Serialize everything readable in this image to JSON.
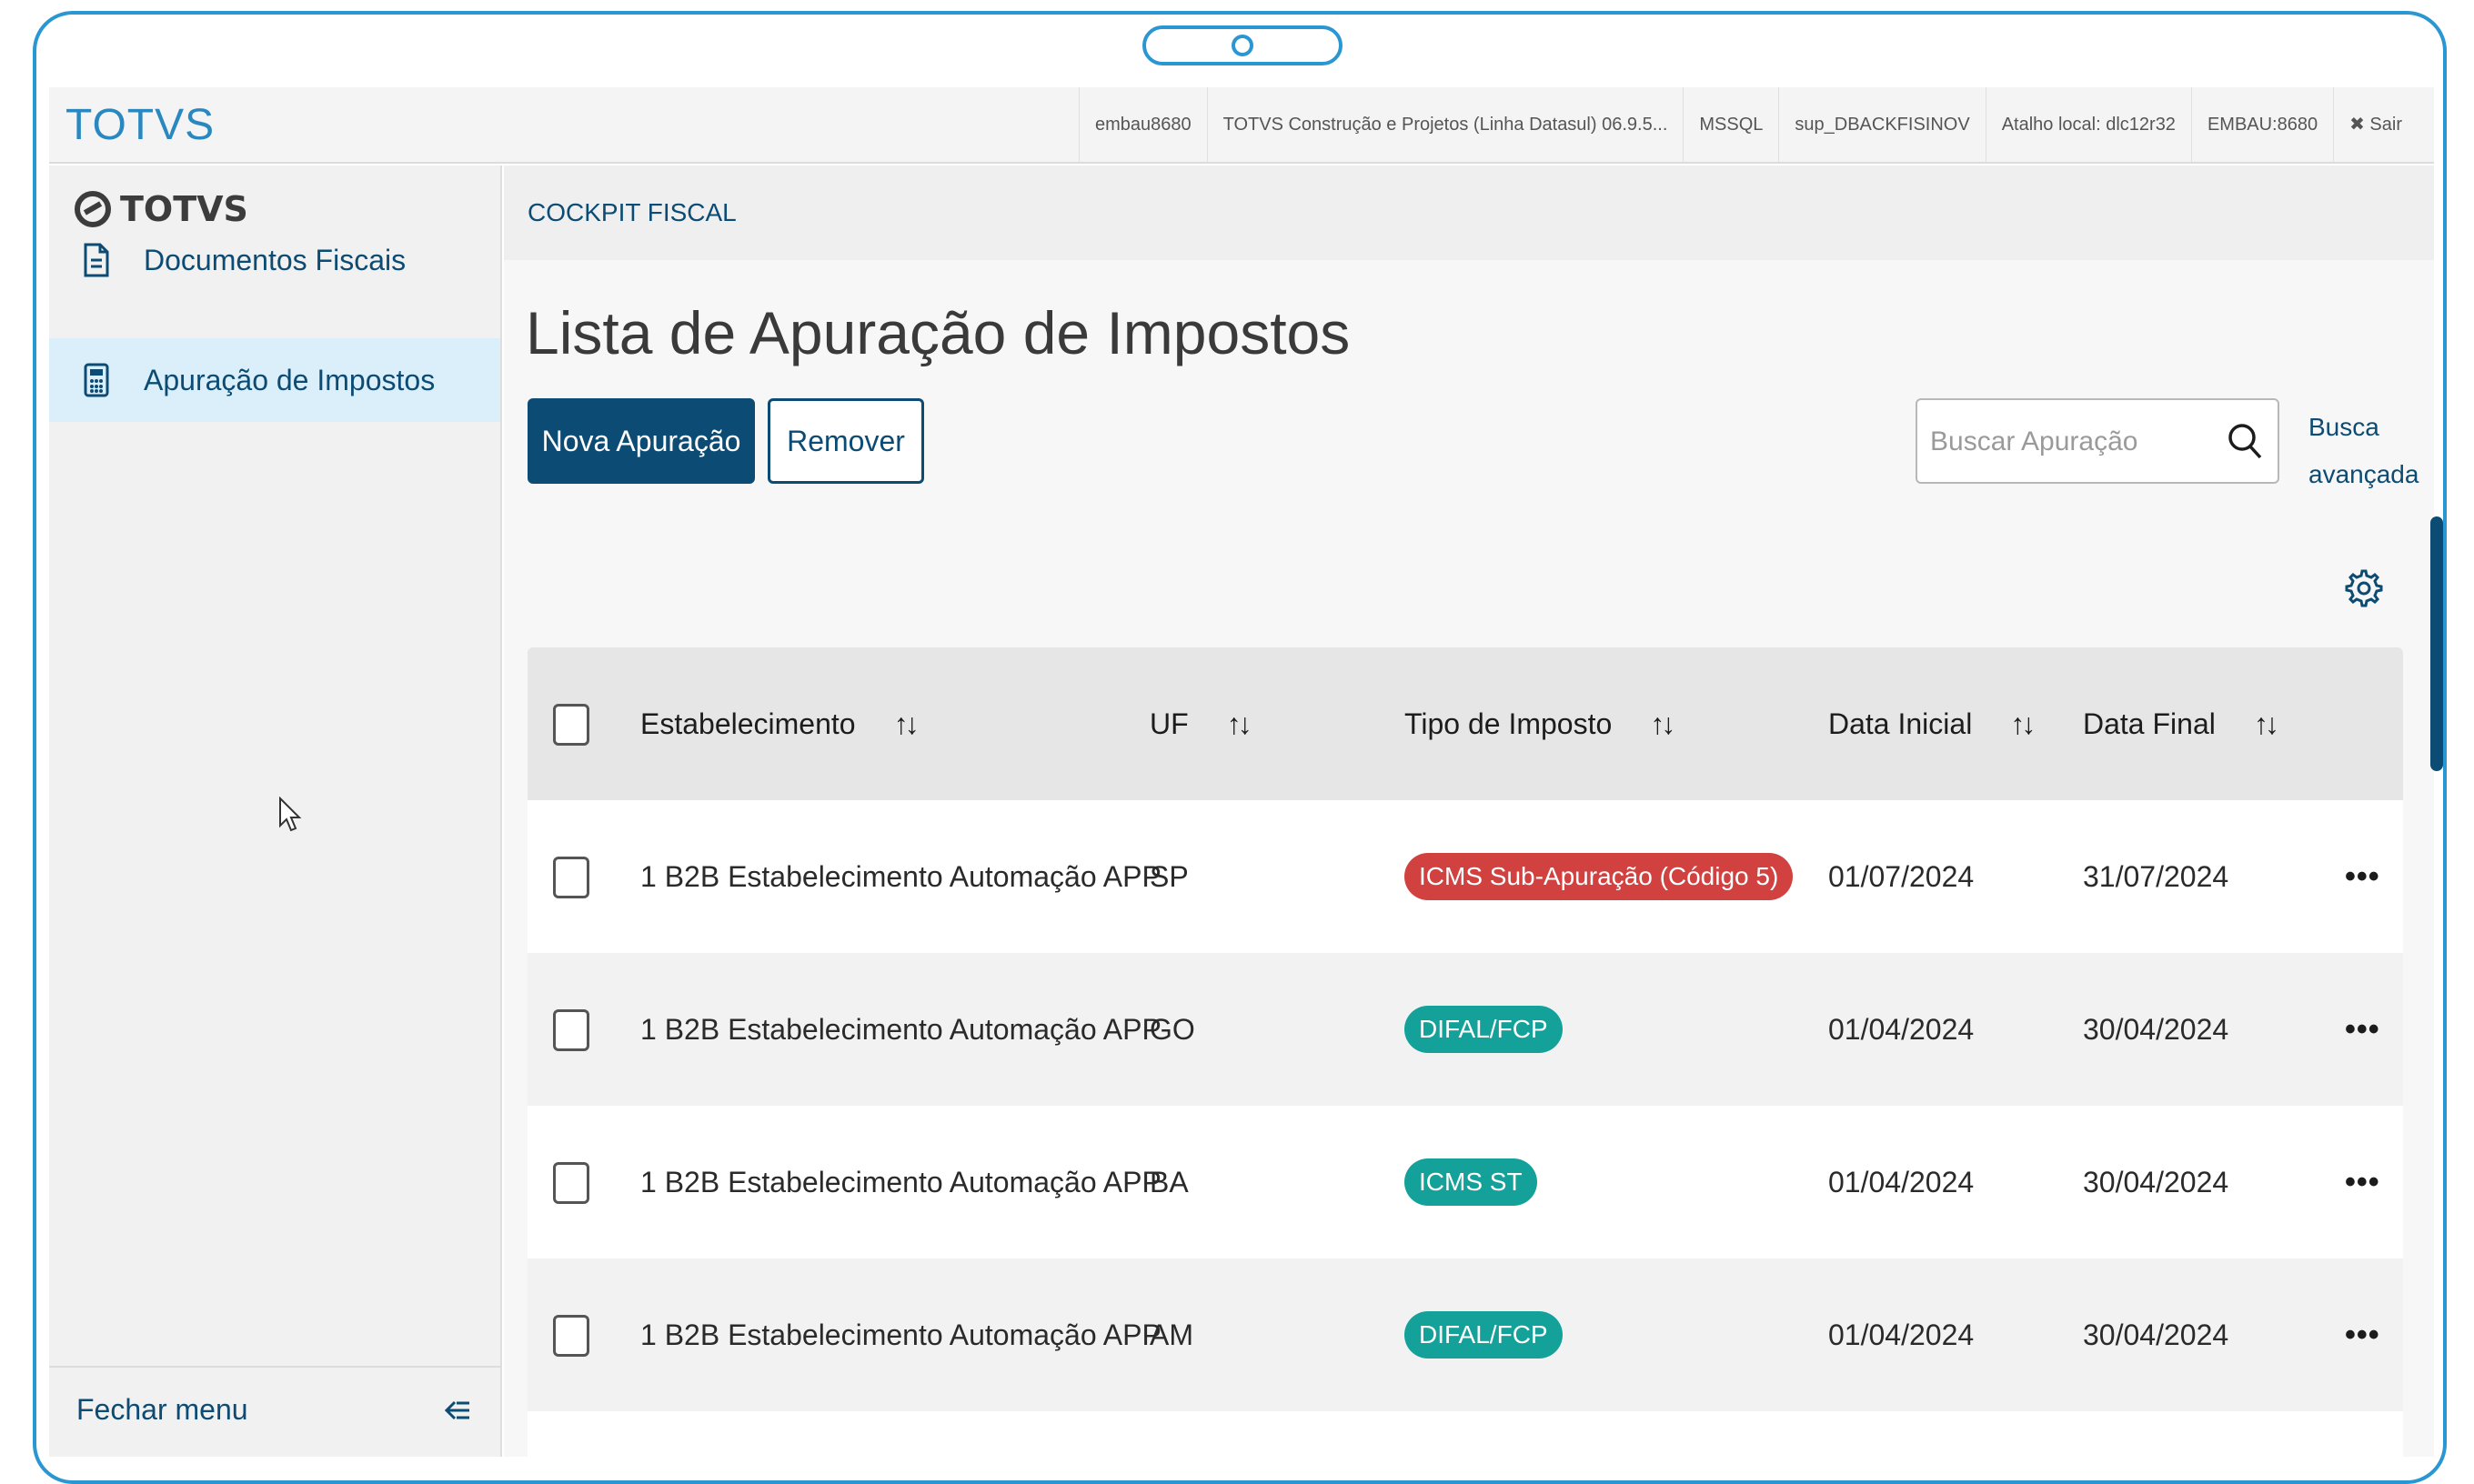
{
  "app": {
    "brand": "TOTVS",
    "sidebar_logo": "TOTVS"
  },
  "topbar": {
    "items": [
      "embau8680",
      "TOTVS Construção e Projetos (Linha Datasul) 06.9.5...",
      "MSSQL",
      "sup_DBACKFISINOV",
      "Atalho local: dlc12r32",
      "EMBAU:8680"
    ],
    "exit_label": "✖ Sair"
  },
  "sidebar": {
    "items": [
      {
        "label": "Documentos Fiscais",
        "icon": "document-icon"
      },
      {
        "label": "Apuração de Impostos",
        "icon": "calculator-icon",
        "active": true
      }
    ],
    "footer_label": "Fechar menu",
    "footer_icon": "collapse-menu-icon"
  },
  "breadcrumb": "COCKPIT FISCAL",
  "page": {
    "title": "Lista de Apuração de Impostos",
    "new_button": "Nova Apuração",
    "remove_button": "Remover",
    "search_placeholder": "Buscar Apuração",
    "advanced_search_line1": "Busca",
    "advanced_search_line2": "avançada"
  },
  "table": {
    "columns": {
      "estabelecimento": "Estabelecimento",
      "uf": "UF",
      "tipo": "Tipo de Imposto",
      "data_inicial": "Data Inicial",
      "data_final": "Data Final"
    },
    "sort_icon": "↑↓",
    "more_icon": "•••",
    "rows": [
      {
        "estabelecimento": "1 B2B Estabelecimento Automação APP",
        "uf": "SP",
        "tipo": "ICMS Sub-Apuração (Código 5)",
        "tipo_color": "#d0413f",
        "data_inicial": "01/07/2024",
        "data_final": "31/07/2024"
      },
      {
        "estabelecimento": "1 B2B Estabelecimento Automação APP",
        "uf": "GO",
        "tipo": "DIFAL/FCP",
        "tipo_color": "#14a19a",
        "data_inicial": "01/04/2024",
        "data_final": "30/04/2024"
      },
      {
        "estabelecimento": "1 B2B Estabelecimento Automação APP",
        "uf": "BA",
        "tipo": "ICMS ST",
        "tipo_color": "#14a19a",
        "data_inicial": "01/04/2024",
        "data_final": "30/04/2024"
      },
      {
        "estabelecimento": "1 B2B Estabelecimento Automação APP",
        "uf": "AM",
        "tipo": "DIFAL/FCP",
        "tipo_color": "#14a19a",
        "data_inicial": "01/04/2024",
        "data_final": "30/04/2024"
      }
    ]
  },
  "colors": {
    "primary": "#0c4b74",
    "frame": "#2a96d2",
    "brand": "#2a88c0",
    "tag_red": "#d0413f",
    "tag_teal": "#14a19a"
  }
}
